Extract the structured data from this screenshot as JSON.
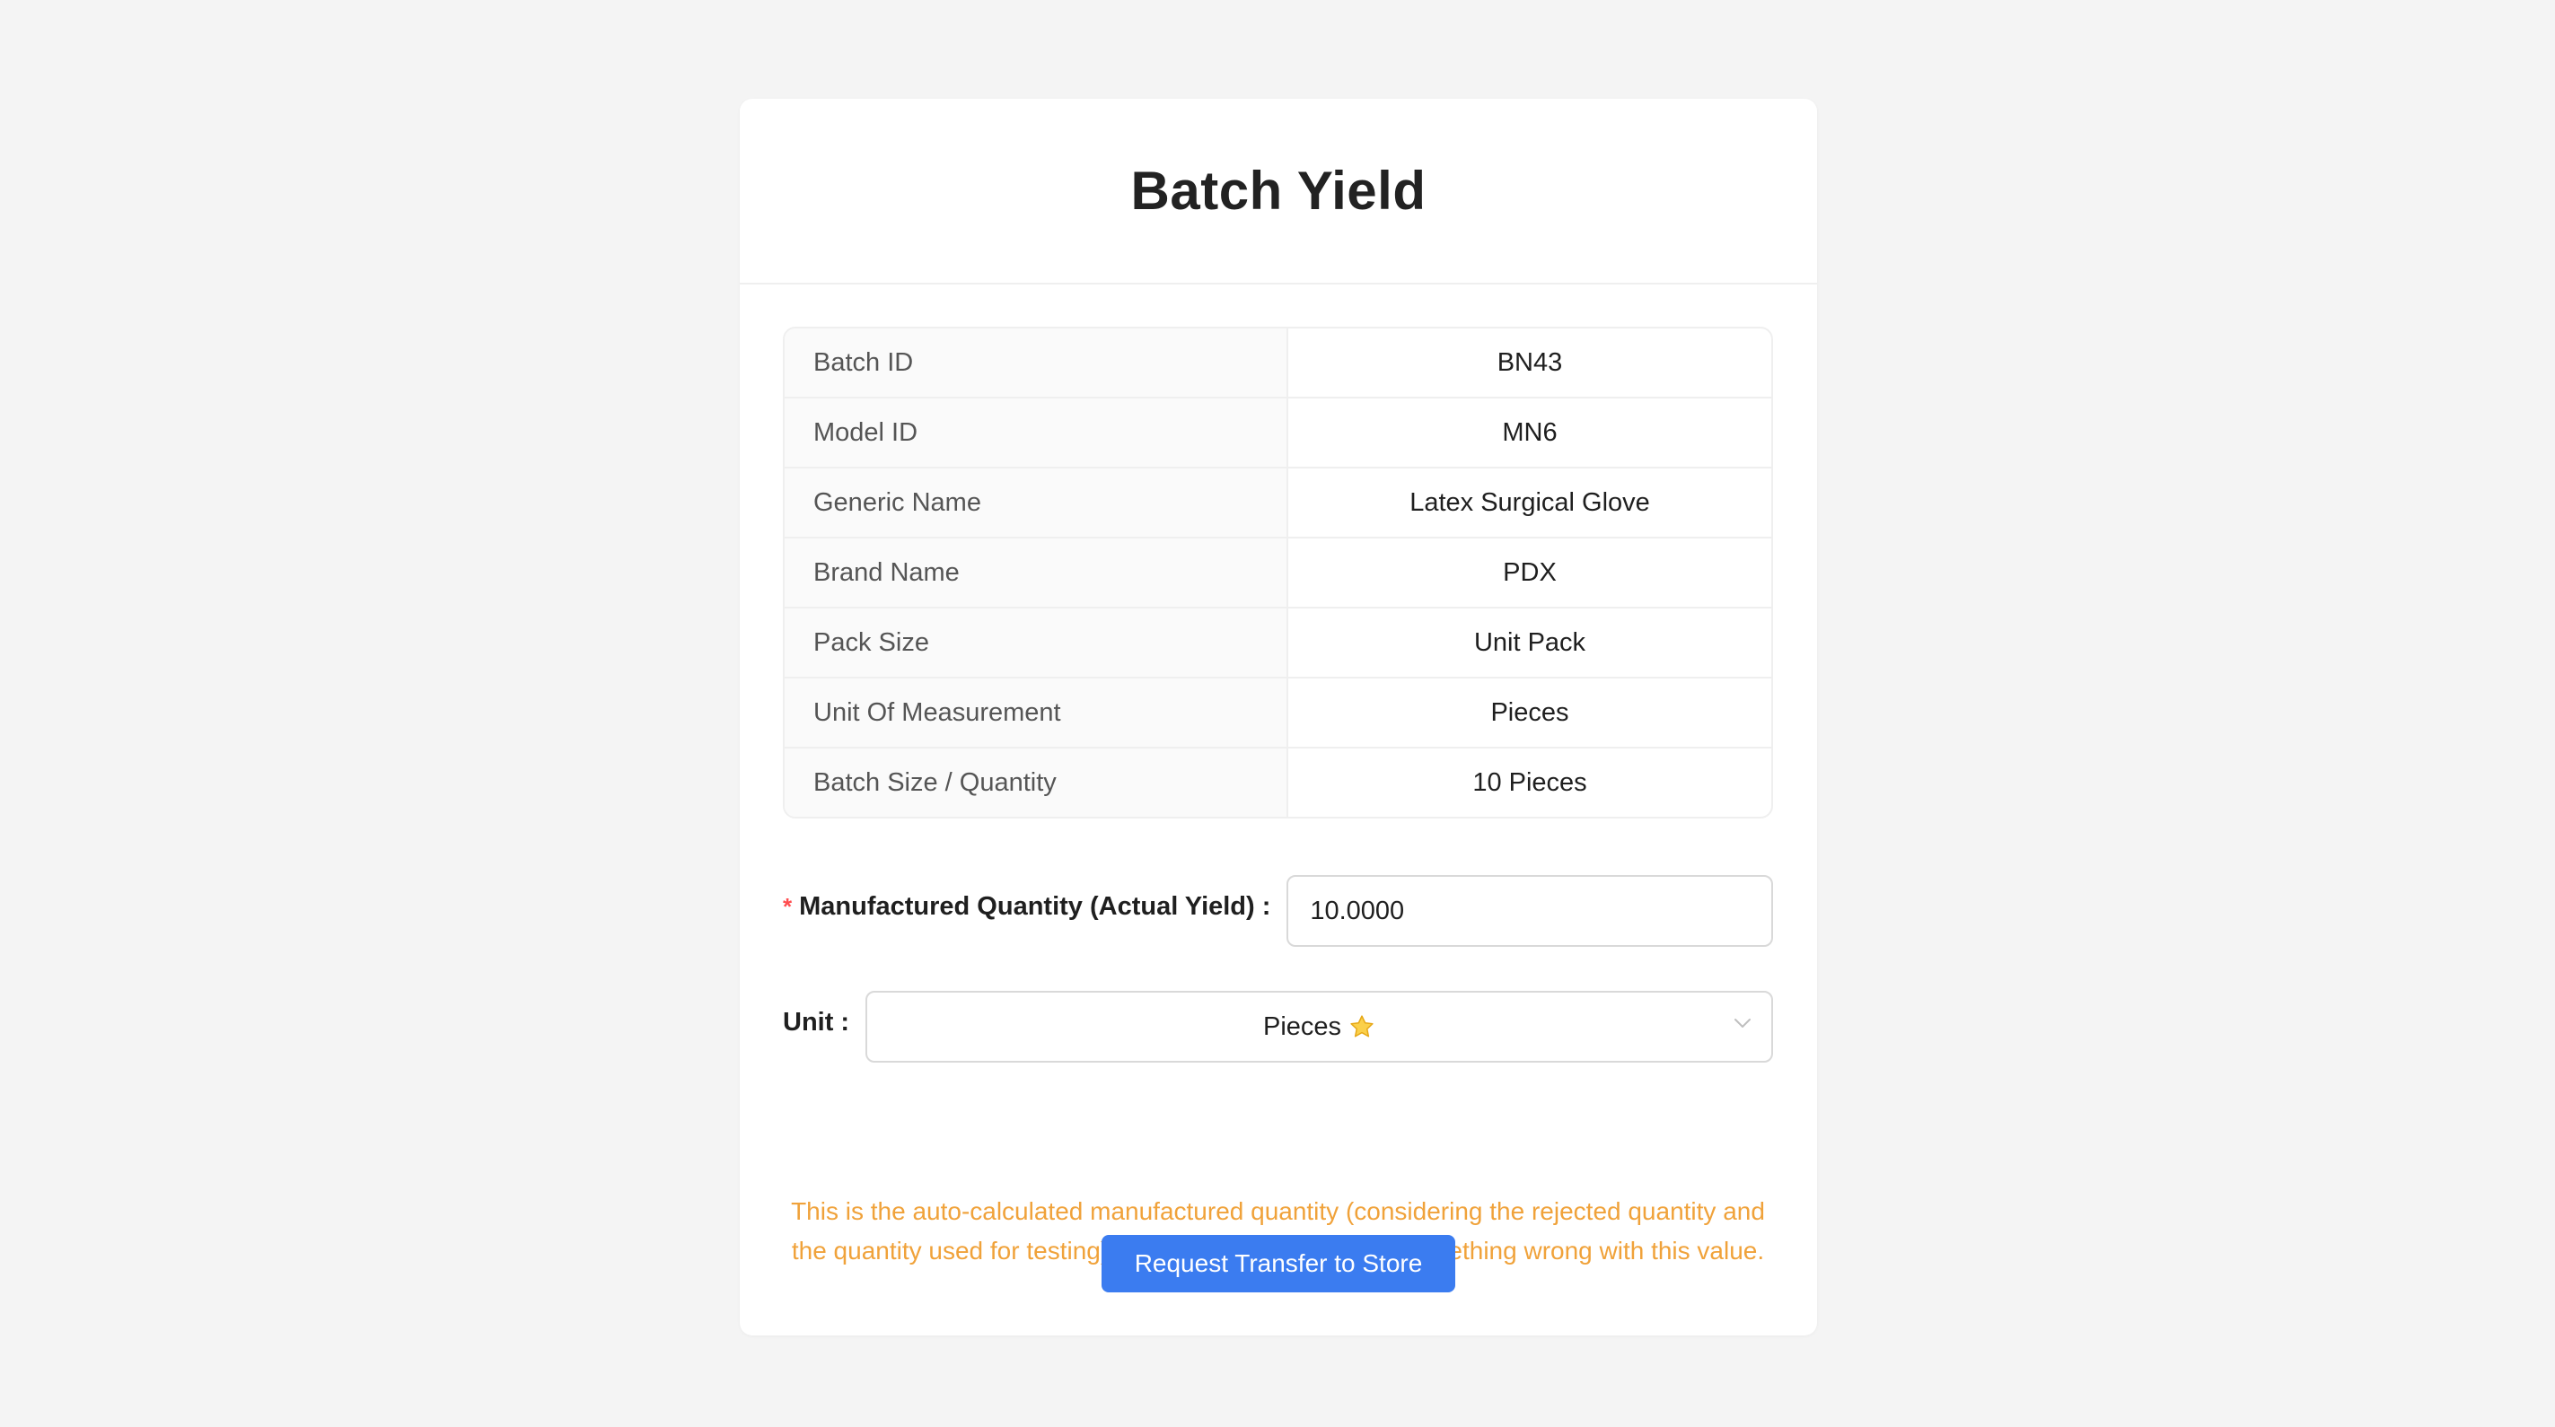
{
  "header": {
    "title": "Batch Yield"
  },
  "details": [
    {
      "label": "Batch ID",
      "value": "BN43"
    },
    {
      "label": "Model ID",
      "value": "MN6"
    },
    {
      "label": "Generic Name",
      "value": "Latex Surgical Glove"
    },
    {
      "label": "Brand Name",
      "value": "PDX"
    },
    {
      "label": "Pack Size",
      "value": "Unit Pack"
    },
    {
      "label": "Unit Of Measurement",
      "value": "Pieces"
    },
    {
      "label": "Batch Size / Quantity",
      "value": "10 Pieces"
    }
  ],
  "form": {
    "quantity": {
      "required_mark": "*",
      "label": "Manufactured Quantity (Actual Yield)",
      "colon": ":",
      "value": "10.0000"
    },
    "unit": {
      "label": "Unit",
      "colon": ":",
      "selected": "Pieces",
      "selected_icon": "star-icon"
    },
    "hint": "This is the auto-calculated manufactured quantity (considering the rejected quantity and the quantity used for testing). You can edit it if you find something wrong with this value.",
    "submit_label": "Request Transfer to Store"
  },
  "colors": {
    "primary": "#3b7cf0",
    "warning_text": "#f0a23a",
    "required": "#ff4d4f",
    "background": "#f4f4f4"
  }
}
